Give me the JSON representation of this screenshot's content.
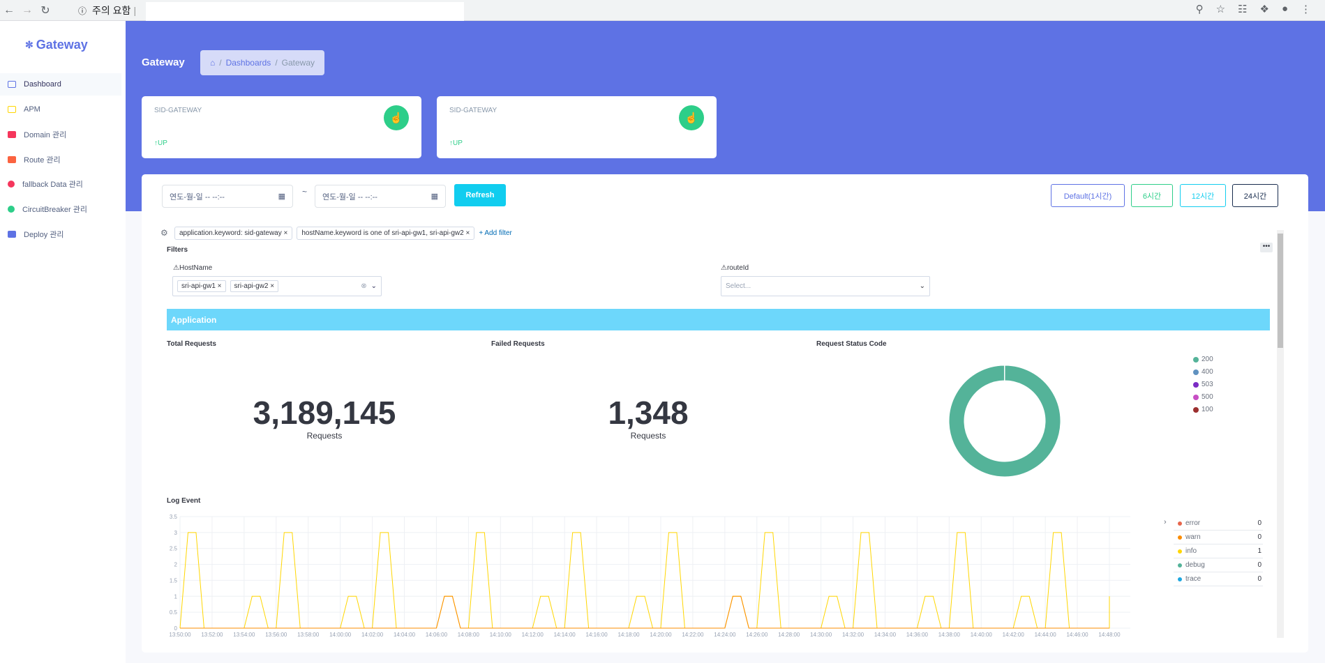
{
  "browser": {
    "warning_text": "주의 요함",
    "back_icon": "arrow-left-icon",
    "forward_icon": "arrow-right-icon",
    "reload_icon": "reload-icon"
  },
  "sidebar": {
    "brand": "Gateway",
    "items": [
      {
        "label": "Dashboard",
        "color": "#5e72e4"
      },
      {
        "label": "APM",
        "color": "#ffd600"
      },
      {
        "label": "Domain 관리",
        "color": "#f5365c"
      },
      {
        "label": "Route 관리",
        "color": "#fb6340"
      },
      {
        "label": "fallback Data 관리",
        "color": "#f5365c"
      },
      {
        "label": "CircuitBreaker 관리",
        "color": "#2dce89"
      },
      {
        "label": "Deploy 관리",
        "color": "#5e72e4"
      }
    ]
  },
  "header": {
    "title": "Gateway",
    "breadcrumb": {
      "home_icon": "home-icon",
      "items": [
        "Dashboards",
        "Gateway"
      ]
    }
  },
  "cards": [
    {
      "label": "SID-GATEWAY",
      "status": "UP",
      "icon": "hand-pointer-icon"
    },
    {
      "label": "SID-GATEWAY",
      "status": "UP",
      "icon": "hand-pointer-icon"
    }
  ],
  "controls": {
    "date_start_placeholder": "연도-월-일 -- --:--",
    "date_end_placeholder": "연도-월-일 -- --:--",
    "tilde": "~",
    "refresh": "Refresh",
    "ranges": [
      {
        "label": "Default(1시간)",
        "color": "#5e72e4"
      },
      {
        "label": "6시간",
        "color": "#2dce89"
      },
      {
        "label": "12시간",
        "color": "#11cdef"
      },
      {
        "label": "24시간",
        "color": "#172b4d"
      }
    ]
  },
  "kibana": {
    "filters": [
      "application.keyword: sid-gateway",
      "hostName.keyword is one of sri-api-gw1, sri-api-gw2"
    ],
    "add_filter": "+ Add filter",
    "filters_title": "Filters",
    "hostname_label": "HostName",
    "hostname_values": [
      "sri-api-gw1",
      "sri-api-gw2"
    ],
    "routeid_label": "routeId",
    "routeid_placeholder": "Select...",
    "section_title": "Application",
    "total_requests": {
      "title": "Total Requests",
      "value": "3,189,145",
      "unit": "Requests"
    },
    "failed_requests": {
      "title": "Failed Requests",
      "value": "1,348",
      "unit": "Requests"
    },
    "status_code": {
      "title": "Request Status Code",
      "legend": [
        {
          "label": "200",
          "color": "#54b399"
        },
        {
          "label": "400",
          "color": "#6092c0"
        },
        {
          "label": "503",
          "color": "#7b2cc4"
        },
        {
          "label": "500",
          "color": "#c74fc4"
        },
        {
          "label": "100",
          "color": "#9b2f2f"
        }
      ]
    },
    "log_event": {
      "title": "Log Event",
      "legend": [
        {
          "label": "error",
          "count": "0",
          "color": "#e7664c"
        },
        {
          "label": "warn",
          "count": "0",
          "color": "#fb8c00"
        },
        {
          "label": "info",
          "count": "1",
          "color": "#ffd600"
        },
        {
          "label": "debug",
          "count": "0",
          "color": "#54b399"
        },
        {
          "label": "trace",
          "count": "0",
          "color": "#1ea7e0"
        }
      ]
    }
  },
  "chart_data": [
    {
      "type": "pie",
      "title": "Request Status Code",
      "categories": [
        "200",
        "400",
        "503",
        "500",
        "100"
      ],
      "values": [
        99.9,
        0.04,
        0.03,
        0.02,
        0.01
      ]
    },
    {
      "type": "line",
      "title": "Log Event",
      "x": [
        "13:50:00",
        "13:52:00",
        "13:54:00",
        "13:56:00",
        "13:58:00",
        "14:00:00",
        "14:02:00",
        "14:04:00",
        "14:06:00",
        "14:08:00",
        "14:10:00",
        "14:12:00",
        "14:14:00",
        "14:16:00",
        "14:18:00",
        "14:20:00",
        "14:22:00",
        "14:24:00",
        "14:26:00",
        "14:28:00",
        "14:30:00",
        "14:32:00",
        "14:34:00",
        "14:36:00",
        "14:38:00",
        "14:40:00",
        "14:42:00",
        "14:44:00",
        "14:46:00",
        "14:48:00"
      ],
      "y_ticks": [
        "0",
        "0.5",
        "1",
        "1.5",
        "2",
        "2.5",
        "3",
        "3.5"
      ],
      "ylim": [
        0,
        3.5
      ],
      "series": [
        {
          "name": "info",
          "color": "#ffd600",
          "values": [
            3,
            0,
            1,
            3,
            0,
            1,
            3,
            0,
            1,
            3,
            0,
            1,
            3,
            0,
            1,
            3,
            0,
            1,
            3,
            0,
            1,
            3,
            0,
            1,
            3,
            0,
            1,
            3,
            0,
            1
          ]
        },
        {
          "name": "warn",
          "color": "#fb8c00",
          "values": [
            0,
            0,
            0,
            0,
            0,
            0,
            0,
            0,
            1,
            0,
            0,
            0,
            0,
            0,
            0,
            0,
            0,
            1,
            0,
            0,
            0,
            0,
            0,
            0,
            0,
            0,
            0,
            0,
            0,
            0
          ]
        }
      ]
    }
  ]
}
